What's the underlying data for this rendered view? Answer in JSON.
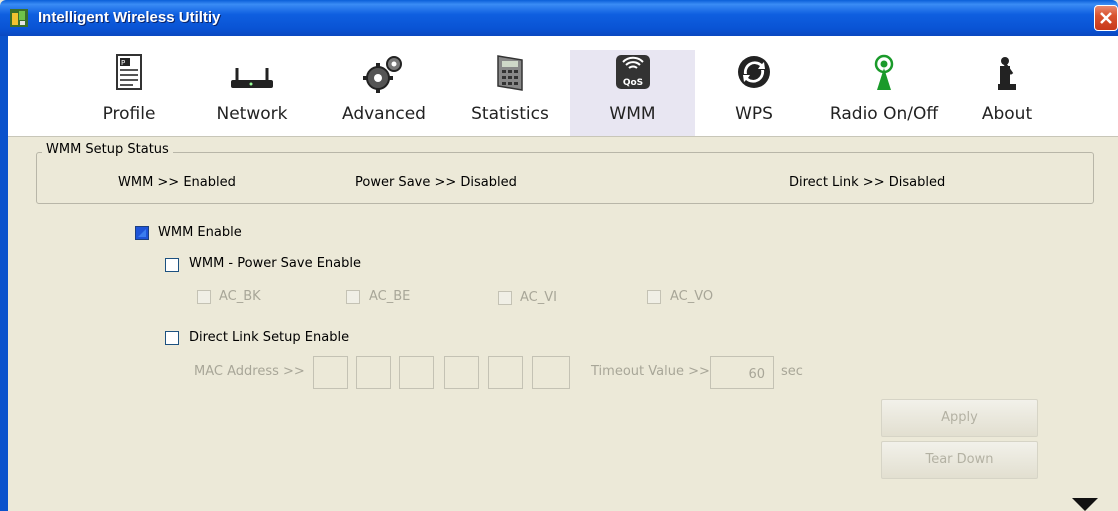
{
  "window": {
    "title": "Intelligent Wireless Utiltiy"
  },
  "toolbar": {
    "items": [
      {
        "label": "Profile",
        "icon": "profile-icon"
      },
      {
        "label": "Network",
        "icon": "network-icon"
      },
      {
        "label": "Advanced",
        "icon": "advanced-icon"
      },
      {
        "label": "Statistics",
        "icon": "statistics-icon"
      },
      {
        "label": "WMM",
        "icon": "wmm-qos-icon",
        "active": true
      },
      {
        "label": "WPS",
        "icon": "wps-icon"
      },
      {
        "label": "Radio On/Off",
        "icon": "radio-icon"
      },
      {
        "label": "About",
        "icon": "about-icon"
      }
    ],
    "qos_badge": "QoS"
  },
  "status": {
    "group_title": "WMM Setup Status",
    "wmm": "WMM >> Enabled",
    "power_save": "Power Save >> Disabled",
    "direct_link": "Direct Link >> Disabled"
  },
  "options": {
    "wmm_enable": {
      "label": "WMM Enable",
      "checked": true
    },
    "power_save_enable": {
      "label": "WMM - Power Save Enable",
      "checked": false
    },
    "ac": [
      "AC_BK",
      "AC_BE",
      "AC_VI",
      "AC_VO"
    ],
    "direct_link_enable": {
      "label": "Direct Link Setup Enable",
      "checked": false
    }
  },
  "direct_link": {
    "mac_label": "MAC Address >>",
    "timeout_label": "Timeout Value >>",
    "timeout_value": "60",
    "timeout_unit": "sec"
  },
  "buttons": {
    "apply": "Apply",
    "tear_down": "Tear Down"
  },
  "colors": {
    "titlebar": "#0a5fd8",
    "background": "#ece9d8",
    "disabled_text": "#a8a698"
  }
}
